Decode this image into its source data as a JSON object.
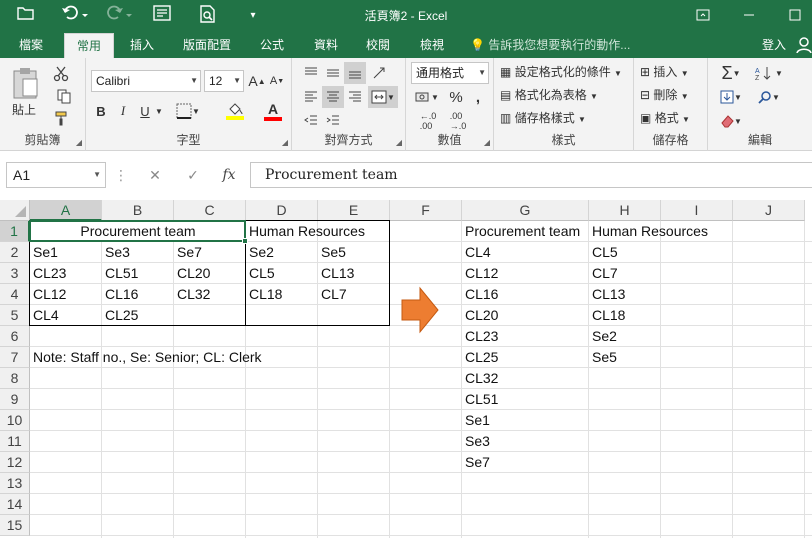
{
  "window": {
    "title": "活頁簿2 - Excel",
    "quick_access": {
      "open_icon": "folder-open-icon",
      "undo_icon": "undo-icon",
      "redo_icon": "redo-icon",
      "form_icon": "form-icon",
      "preview_icon": "print-preview-icon",
      "customize_icon": "customize-qat-icon"
    },
    "controls": {
      "ribbon_display": "ribbon-display-icon",
      "minimize": "minimize-icon",
      "maximize": "maximize-icon",
      "close": "close-icon"
    }
  },
  "menu": {
    "tabs": [
      "檔案",
      "常用",
      "插入",
      "版面配置",
      "公式",
      "資料",
      "校閱",
      "檢視"
    ],
    "active_tab": "常用",
    "tell_me": "告訴我您想要執行的動作...",
    "login": "登入"
  },
  "ribbon": {
    "clipboard": {
      "paste": "貼上",
      "label": "剪貼簿"
    },
    "font": {
      "name": "Calibri",
      "size": "12",
      "bold": "B",
      "italic": "I",
      "underline": "U",
      "grow": "A",
      "shrink": "A",
      "label": "字型",
      "fill_color": "#FFFF00",
      "font_color": "#FF0000"
    },
    "alignment": {
      "label": "對齊方式"
    },
    "number": {
      "format": "通用格式",
      "percent": "%",
      "comma": ",",
      "label": "數值"
    },
    "styles": {
      "conditional": "設定格式化的條件",
      "table": "格式化為表格",
      "cell_styles": "儲存格樣式",
      "label": "樣式"
    },
    "cells": {
      "insert": "插入",
      "delete": "刪除",
      "format": "格式",
      "label": "儲存格"
    },
    "editing": {
      "sum": "Σ",
      "label": "編輯"
    }
  },
  "formula_bar": {
    "name_box": "A1",
    "cancel": "✕",
    "enter": "✓",
    "fx": "fx",
    "content": "Procurement team"
  },
  "sheet": {
    "columns": [
      "A",
      "B",
      "C",
      "D",
      "E",
      "F",
      "G",
      "H",
      "I",
      "J"
    ],
    "rows": [
      "1",
      "2",
      "3",
      "4",
      "5",
      "6",
      "7",
      "8",
      "9",
      "10",
      "11",
      "12",
      "13",
      "14",
      "15"
    ],
    "selected_cell": "A1",
    "cells": {
      "A1": "Procurement team",
      "D1": "Human Resources",
      "A2": "Se1",
      "B2": "Se3",
      "C2": "Se7",
      "D2": "Se2",
      "E2": "Se5",
      "A3": "CL23",
      "B3": "CL51",
      "C3": "CL20",
      "D3": "CL5",
      "E3": "CL13",
      "A4": "CL12",
      "B4": "CL16",
      "C4": "CL32",
      "D4": "CL18",
      "E4": "CL7",
      "A5": "CL4",
      "B5": "CL25",
      "A7": "Note: Staff no., Se: Senior; CL: Clerk",
      "G1": "Procurement team",
      "H1": "Human Resources",
      "G2": "CL4",
      "H2": "CL5",
      "G3": "CL12",
      "H3": "CL7",
      "G4": "CL16",
      "H4": "CL13",
      "G5": "CL20",
      "H5": "CL18",
      "G6": "CL23",
      "H6": "Se2",
      "G7": "CL25",
      "H7": "Se5",
      "G8": "CL32",
      "G9": "CL51",
      "G10": "Se1",
      "G11": "Se3",
      "G12": "Se7"
    },
    "arrow_color": "#ED7D31"
  }
}
